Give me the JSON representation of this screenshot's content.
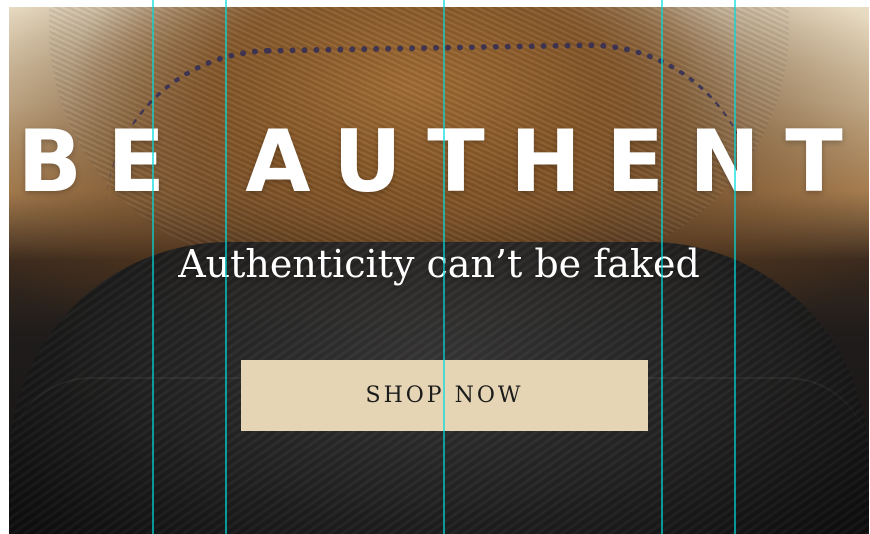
{
  "hero": {
    "headline": "BE AUTHENTIC",
    "subheadline": "Authenticity can’t be faked",
    "cta_label": "SHOP NOW"
  },
  "guides": {
    "color": "#00dcdc"
  }
}
